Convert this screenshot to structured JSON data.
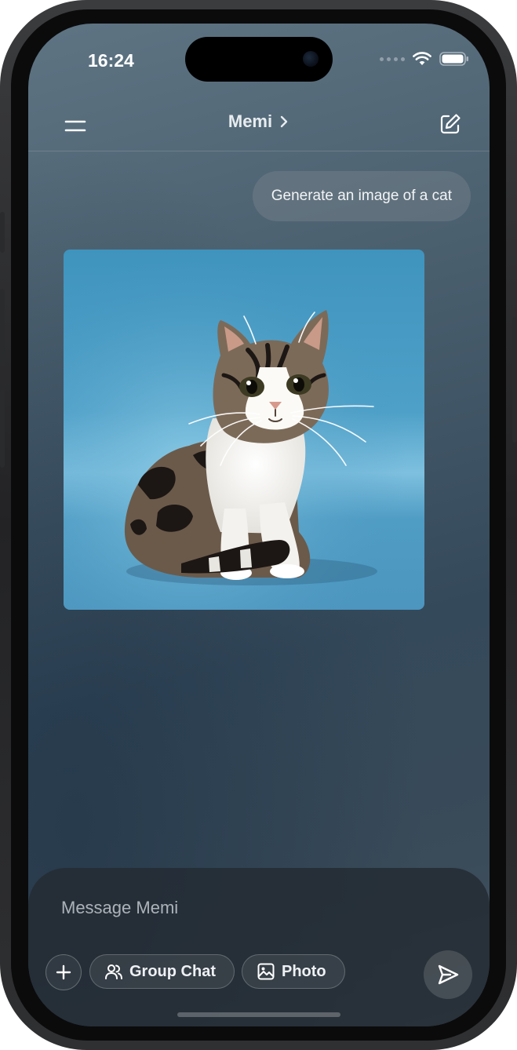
{
  "status_bar": {
    "time": "16:24",
    "icons": [
      "signal-dots-icon",
      "wifi-icon",
      "battery-icon"
    ]
  },
  "header": {
    "title": "Memi",
    "left_icon": "menu-icon",
    "right_icon": "compose-icon",
    "title_icon": "chevron-right-icon"
  },
  "messages": [
    {
      "role": "user",
      "text": "Generate an image of a cat"
    },
    {
      "role": "assistant",
      "type": "image",
      "subject": "cat-image"
    }
  ],
  "composer": {
    "placeholder": "Message Memi",
    "add_icon": "plus-icon",
    "chips": [
      {
        "label": "Group Chat",
        "icon": "people-icon"
      },
      {
        "label": "Photo",
        "icon": "image-icon"
      }
    ],
    "send_icon": "send-icon"
  },
  "colors": {
    "screen_bg_top": "#5e7483",
    "screen_bg_bottom": "#34495a",
    "image_bg": "#4ea0c8",
    "text": "#e8ecef"
  }
}
